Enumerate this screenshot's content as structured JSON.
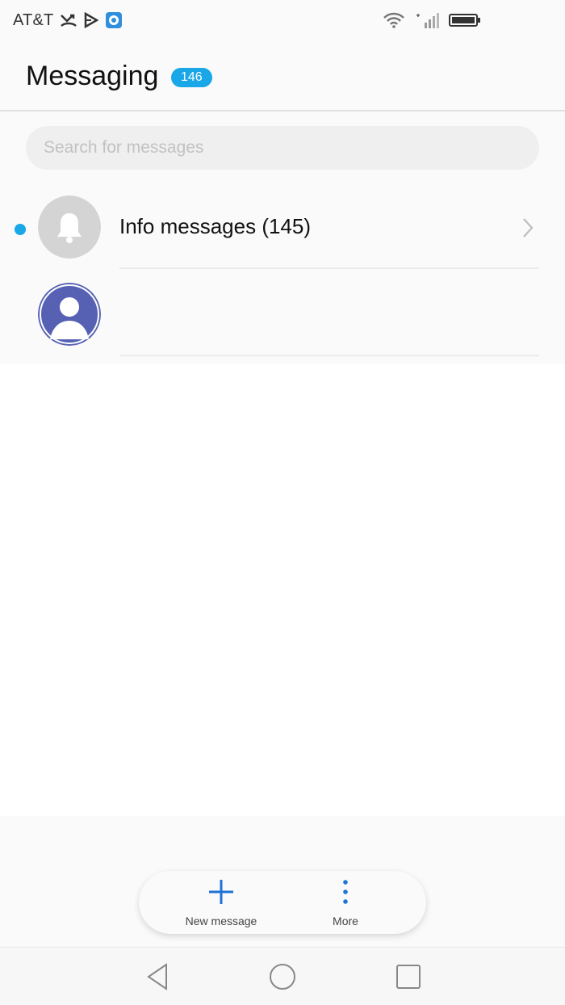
{
  "status_bar": {
    "carrier": "AT&T",
    "icons_left": [
      "missed-call-icon",
      "play-store-icon",
      "shield-app-icon"
    ],
    "icons_right": [
      "wifi-icon",
      "cell-signal-icon",
      "battery-icon"
    ]
  },
  "header": {
    "title": "Messaging",
    "badge_count": "146"
  },
  "search": {
    "placeholder": "Search for messages"
  },
  "conversations": [
    {
      "title": "Info messages (145)",
      "icon": "bell-icon",
      "unread": true
    },
    {
      "title": "",
      "icon": "person-icon",
      "unread": false
    }
  ],
  "actions": {
    "new_message_label": "New message",
    "more_label": "More"
  },
  "navigation": [
    "back-icon",
    "home-icon",
    "recents-icon"
  ],
  "colors": {
    "accent": "#1aa7e8",
    "avatar_contact": "#5661b3",
    "avatar_info": "#d4d4d4",
    "action_icon": "#1e73d6"
  }
}
